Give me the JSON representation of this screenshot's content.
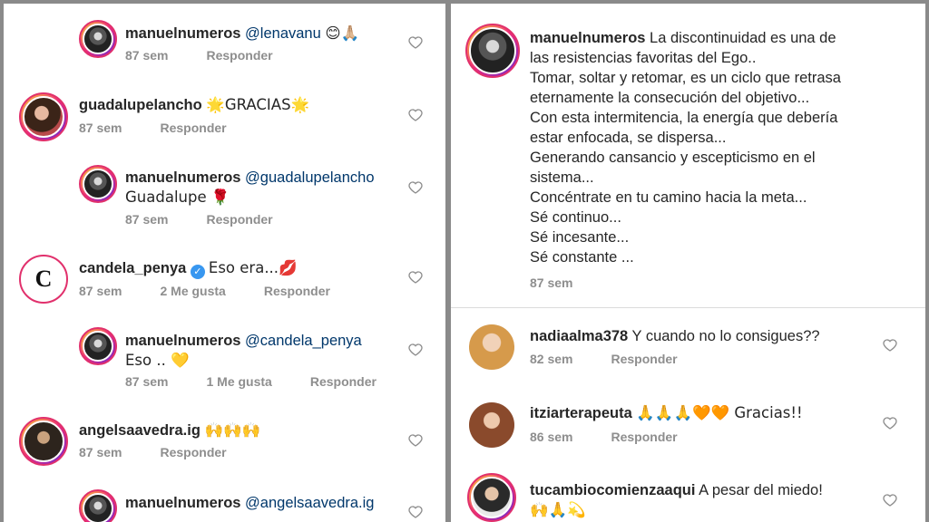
{
  "left": {
    "c1": {
      "user": "manuelnumeros",
      "mention": "@lenavanu",
      "emoji": "😊🙏🏼",
      "time": "87 sem",
      "reply": "Responder"
    },
    "c2": {
      "user": "guadalupelancho",
      "text": "🌟GRACIAS🌟",
      "time": "87 sem",
      "reply": "Responder"
    },
    "c3": {
      "user": "manuelnumeros",
      "mention": "@guadalupelancho",
      "line2": "Guadalupe 🌹",
      "time": "87 sem",
      "reply": "Responder"
    },
    "c4": {
      "user": "candela_penya",
      "text": "Eso era...💋",
      "time": "87 sem",
      "likes": "2 Me gusta",
      "reply": "Responder",
      "avatar_letter": "C"
    },
    "c5": {
      "user": "manuelnumeros",
      "mention": "@candela_penya",
      "line2": "Eso .. 💛",
      "time": "87 sem",
      "likes": "1 Me gusta",
      "reply": "Responder"
    },
    "c6": {
      "user": "angelsaavedra.ig",
      "text": "🙌🙌🙌",
      "time": "87 sem",
      "reply": "Responder"
    },
    "c7": {
      "user": "manuelnumeros",
      "mention": "@angelsaavedra.ig"
    }
  },
  "right": {
    "main": {
      "user": "manuelnumeros",
      "lines": [
        "La discontinuidad es una de",
        "las resistencias favoritas del Ego..",
        "Tomar, soltar y retomar, es un ciclo que retrasa",
        "eternamente  la consecución del objetivo...",
        "Con esta intermitencia, la energía que debería",
        "estar enfocada, se dispersa...",
        "Generando cansancio y escepticismo en el",
        "sistema...",
        "Concéntrate en tu camino hacia la meta...",
        "Sé continuo...",
        "Sé incesante...",
        "Sé constante ..."
      ],
      "time": "87 sem"
    },
    "r1": {
      "user": "nadiaalma378",
      "text": "Y cuando no lo consigues??",
      "time": "82 sem",
      "reply": "Responder"
    },
    "r2": {
      "user": "itziarterapeuta",
      "text": "🙏🙏🙏🧡🧡 Gracias!!",
      "time": "86 sem",
      "reply": "Responder"
    },
    "r3": {
      "user": "tucambiocomienzaaqui",
      "text": "A pesar del miedo!",
      "line2": "🙌🙏💫"
    }
  },
  "icons": {
    "like": "heart-icon",
    "verified": "verified-badge-icon"
  },
  "colors": {
    "text": "#262626",
    "muted": "#8e8e8e",
    "mention": "#00376b",
    "verified": "#3897f0"
  }
}
